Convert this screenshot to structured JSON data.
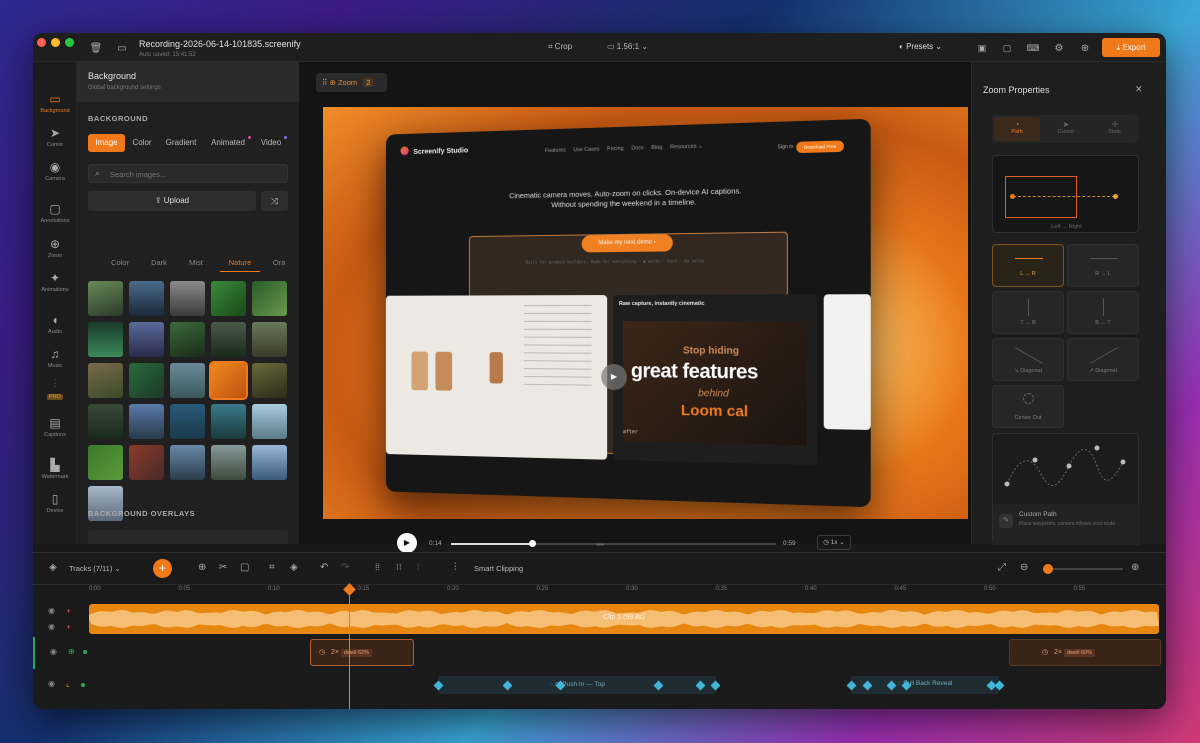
{
  "titlebar": {
    "filename": "Recording-2026-06-14-101835.screenify",
    "autosave": "Auto saved: 15:41:52",
    "crop_label": "Crop",
    "aspect_label": "1.56:1",
    "presets_label": "Presets",
    "export_label": "Export"
  },
  "nav": [
    {
      "label": "Background",
      "icon": "monitor-icon"
    },
    {
      "label": "Cursor",
      "icon": "cursor-icon"
    },
    {
      "label": "Camera",
      "icon": "camera-icon"
    },
    {
      "label": "Annotations",
      "icon": "annotation-icon"
    },
    {
      "label": "Zoom",
      "icon": "zoom-icon"
    },
    {
      "label": "Animations",
      "icon": "sparkle-icon"
    },
    {
      "label": "Audio",
      "icon": "speaker-icon"
    },
    {
      "label": "Music",
      "icon": "music-icon"
    },
    {
      "label": "PRO",
      "icon": "waveform-icon"
    },
    {
      "label": "Captions",
      "icon": "captions-icon"
    },
    {
      "label": "Watermark",
      "icon": "watermark-icon"
    },
    {
      "label": "Device",
      "icon": "device-icon"
    }
  ],
  "panel": {
    "title": "Background",
    "subtitle": "Global background settings",
    "section": "BACKGROUND",
    "tabs": [
      "Image",
      "Color",
      "Gradient",
      "Animated",
      "Video"
    ],
    "search_placeholder": "Search images...",
    "upload_label": "Upload",
    "categories": [
      "Color",
      "Dark",
      "Mist",
      "Nature",
      "Ora"
    ],
    "overlays_title": "BACKGROUND OVERLAYS"
  },
  "stage": {
    "zoom_badge": "Zoom",
    "zoom_count": "2",
    "brand": "Screenify Studio",
    "nav_links": [
      "Features",
      "Use Cases",
      "Pricing",
      "Docs",
      "Blog",
      "Resources"
    ],
    "signin": "Sign in",
    "download": "Download Free",
    "headline": "Cinematic camera moves. Auto-zoom on clicks. On-device AI captions.",
    "subhead": "Without spending the weekend in a timeline.",
    "cta": "Make my next demo",
    "tagline": "Built for product builders. Made for everything — ● works · Fast · No setup",
    "card_title": "Raw capture, instantly cinematic",
    "feat1": "Stop hiding",
    "feat2": "great features",
    "feat3": "behind",
    "feat4": "Loom cal",
    "after": "after",
    "time_current": "0:14",
    "time_total": "0:59",
    "speed": "1x"
  },
  "props": {
    "title": "Zoom Properties",
    "tabs": [
      "Path",
      "Cursor",
      "Static"
    ],
    "path_caption": "Left → Right",
    "options": [
      "L → R",
      "R → L",
      "T → B",
      "B → T",
      "↘ Diagonal",
      "↗ Diagonal",
      "Center Out"
    ],
    "custom_title": "Custom Path",
    "custom_desc": "Place waypoints, camera follows your route"
  },
  "timeline": {
    "tracks_label": "Tracks (7/11)",
    "smart_label": "Smart Clipping",
    "ticks": [
      "0:00",
      "0:05",
      "0:10",
      "0:15",
      "0:20",
      "0:25",
      "0:30",
      "0:35",
      "0:40",
      "0:45",
      "0:50",
      "0:55"
    ],
    "audio_clip": "Clip 1 (59.8s)",
    "zoom1_mult": "2×",
    "zoom1_dwell": "dwell 62%",
    "zoom2_mult": "2×",
    "zoom2_dwell": "dwell 60%",
    "path1": "Push In — Top",
    "path2": "Pull Back Reveal",
    "zoom_level": 0.05
  },
  "colors": {
    "accent": "#f07a1a",
    "keyframe": "#3fb6d8"
  }
}
